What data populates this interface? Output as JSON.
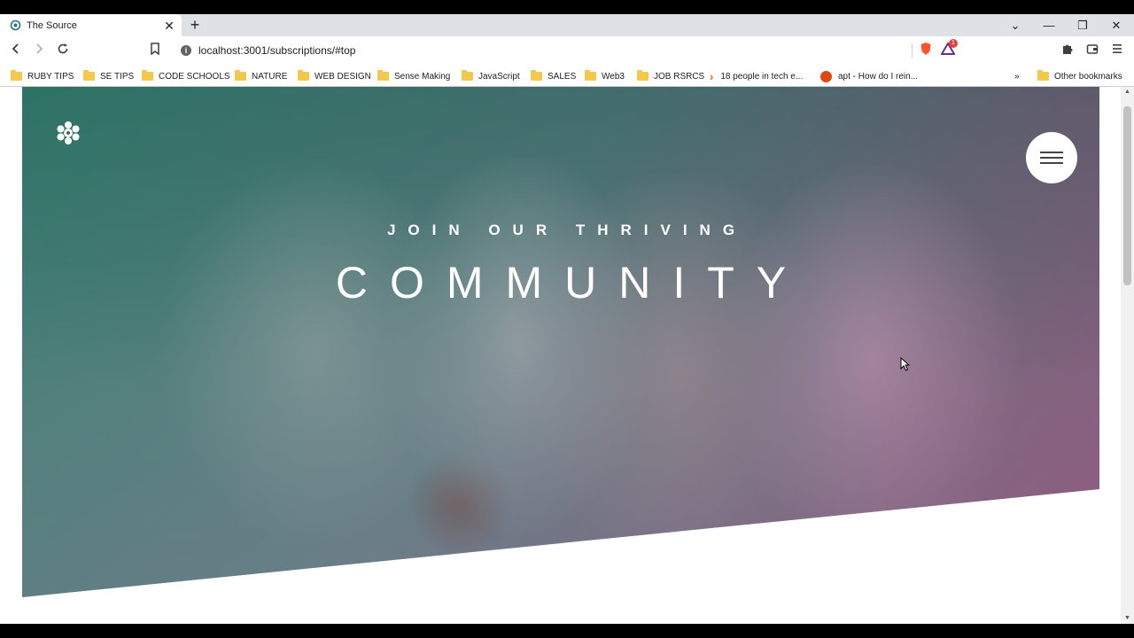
{
  "browser": {
    "tab_title": "The Source",
    "tab_close": "✕",
    "new_tab": "+",
    "url": "localhost:3001/subscriptions/#top",
    "controls": {
      "minimize": "—",
      "restore": "❐",
      "close": "✕",
      "tab_search": "⌄"
    },
    "nav": {
      "back": "◀",
      "forward": "▶",
      "reload": "↻",
      "bookmark": "☐"
    },
    "bookmarks": [
      {
        "label": "RUBY TIPS",
        "icon": "folder-icon"
      },
      {
        "label": "SE TIPS",
        "icon": "folder-icon"
      },
      {
        "label": "CODE SCHOOLS",
        "icon": "folder-icon"
      },
      {
        "label": "NATURE",
        "icon": "folder-icon"
      },
      {
        "label": "WEB DESIGN",
        "icon": "folder-icon"
      },
      {
        "label": "Sense Making",
        "icon": "folder-icon"
      },
      {
        "label": "JavaScript",
        "icon": "folder-icon"
      },
      {
        "label": "SALES",
        "icon": "folder-icon"
      },
      {
        "label": "Web3",
        "icon": "folder-icon"
      },
      {
        "label": "JOB RSRCS",
        "icon": "folder-icon"
      },
      {
        "label": "18 people in tech e...",
        "icon": "chevron-icon"
      },
      {
        "label": "apt - How do I rein...",
        "icon": "askubuntu-icon"
      }
    ],
    "more_bookmarks": "»",
    "other_bookmarks": "Other bookmarks",
    "brave_badge": "1"
  },
  "hero": {
    "kicker": "JOIN OUR THRIVING",
    "headline": "COMMUNITY"
  },
  "colors": {
    "overlay_start": "#1e786e",
    "overlay_end": "#963c78",
    "text": "#ffffff"
  }
}
